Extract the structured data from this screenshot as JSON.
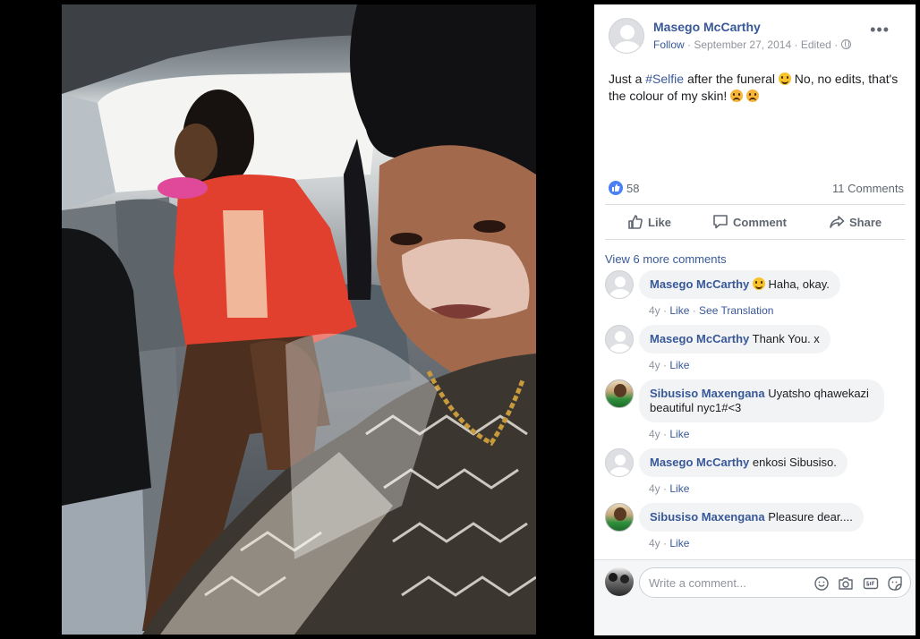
{
  "post": {
    "author": "Masego McCarthy",
    "follow": "Follow",
    "date": "September 27, 2014",
    "edited": "Edited",
    "text_before": "Just a ",
    "hashtag": "#Selfie",
    "text_middle": " after the funeral ",
    "text_after": " No, no edits, that's the colour of my skin! ",
    "emojis": [
      "smile-emoji",
      "frown-emoji",
      "frown-emoji"
    ]
  },
  "stats": {
    "likes": "58",
    "comments": "11 Comments"
  },
  "actions": {
    "like": "Like",
    "comment": "Comment",
    "share": "Share"
  },
  "comments": {
    "view_more": "View 6 more comments",
    "items": [
      {
        "name": "Masego McCarthy",
        "text": " Haha, okay.",
        "age": "4y",
        "like": "Like",
        "extra": "See Translation",
        "avatar": "gray"
      },
      {
        "name": "Masego McCarthy",
        "text": " Thank You. x",
        "age": "4y",
        "like": "Like",
        "avatar": "gray"
      },
      {
        "name": "Sibusiso Maxengana",
        "text": " Uyatsho qhawekazi beautiful nyc1#<3",
        "age": "4y",
        "like": "Like",
        "avatar": "photo"
      },
      {
        "name": "Masego McCarthy",
        "text": " enkosi Sibusiso.",
        "age": "4y",
        "like": "Like",
        "avatar": "gray"
      },
      {
        "name": "Sibusiso Maxengana",
        "text": " Pleasure dear....",
        "age": "4y",
        "like": "Like",
        "avatar": "photo"
      }
    ]
  },
  "composer": {
    "placeholder": "Write a comment..."
  },
  "icons": [
    "globe-icon",
    "more-options-icon",
    "like-reaction-icon",
    "thumbs-up-icon",
    "comment-icon",
    "share-icon",
    "emoji-picker-icon",
    "camera-icon",
    "gif-icon",
    "sticker-icon"
  ],
  "colors": {
    "link": "#385898",
    "like_blue": "#4a80f4",
    "muted": "#90949c",
    "bubble": "#f2f3f5"
  }
}
